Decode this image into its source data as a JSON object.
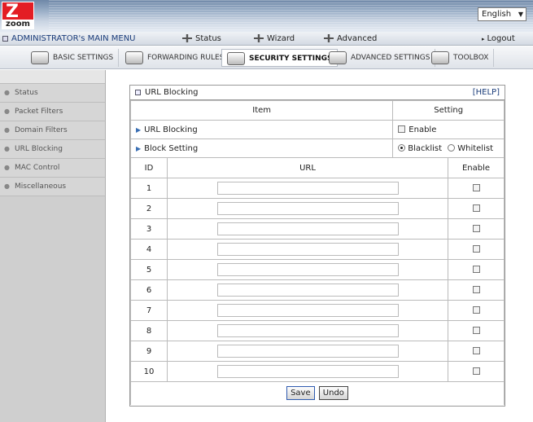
{
  "header": {
    "logo_text": "zoom",
    "language": "English"
  },
  "nav": {
    "admin_menu": "ADMINISTRATOR's MAIN MENU",
    "status": "Status",
    "wizard": "Wizard",
    "advanced": "Advanced",
    "logout": "Logout"
  },
  "tabs": [
    {
      "label": "BASIC SETTINGS",
      "icon": "basic-settings-icon"
    },
    {
      "label": "FORWARDING RULES",
      "icon": "forwarding-rules-icon"
    },
    {
      "label": "SECURITY SETTINGS",
      "icon": "security-settings-icon",
      "active": true
    },
    {
      "label": "ADVANCED SETTINGS",
      "icon": "advanced-settings-icon"
    },
    {
      "label": "TOOLBOX",
      "icon": "toolbox-icon"
    }
  ],
  "sidebar": {
    "items": [
      {
        "label": "Status"
      },
      {
        "label": "Packet Filters"
      },
      {
        "label": "Domain Filters"
      },
      {
        "label": "URL Blocking"
      },
      {
        "label": "MAC Control"
      },
      {
        "label": "Miscellaneous"
      }
    ]
  },
  "panel": {
    "title": "URL Blocking",
    "help": "[HELP]",
    "col_item": "Item",
    "col_setting": "Setting",
    "url_blocking_label": "URL Blocking",
    "enable_label": "Enable",
    "block_setting_label": "Block Setting",
    "blacklist_label": "Blacklist",
    "whitelist_label": "Whitelist",
    "selected_mode": "Blacklist",
    "col_id": "ID",
    "col_url": "URL",
    "col_enable": "Enable",
    "rows": [
      {
        "id": "1",
        "url": ""
      },
      {
        "id": "2",
        "url": ""
      },
      {
        "id": "3",
        "url": ""
      },
      {
        "id": "4",
        "url": ""
      },
      {
        "id": "5",
        "url": ""
      },
      {
        "id": "6",
        "url": ""
      },
      {
        "id": "7",
        "url": ""
      },
      {
        "id": "8",
        "url": ""
      },
      {
        "id": "9",
        "url": ""
      },
      {
        "id": "10",
        "url": ""
      }
    ],
    "save_label": "Save",
    "undo_label": "Undo"
  },
  "colors": {
    "logo_red": "#e31d24",
    "link_blue": "#1a3c7a",
    "sidebar_gray": "#cfcfcf"
  }
}
